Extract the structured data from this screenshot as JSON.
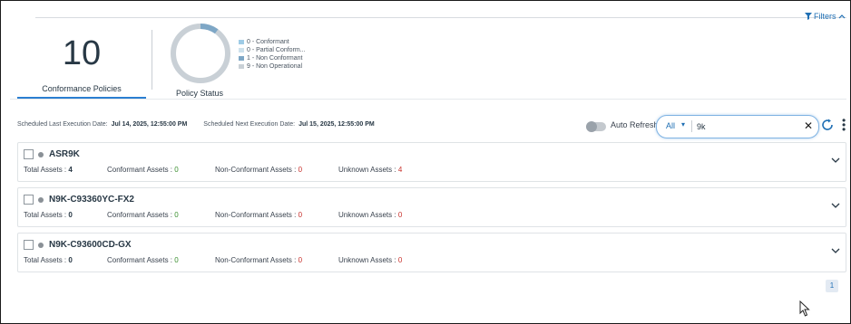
{
  "filters": {
    "label": "Filters"
  },
  "kpi": {
    "value": "10",
    "label": "Conformance Policies"
  },
  "policy_status": {
    "label": "Policy Status",
    "legend": [
      {
        "text": "0 - Conformant",
        "color": "#9ecbe6"
      },
      {
        "text": "0 - Partial Conform...",
        "color": "#cde1ec"
      },
      {
        "text": "1 - Non Conformant",
        "color": "#7ea7c6"
      },
      {
        "text": "9 - Non Operational",
        "color": "#c9d0d6"
      }
    ]
  },
  "schedule": {
    "last_label": "Scheduled Last Execution Date:",
    "last_value": "Jul 14, 2025, 12:55:00 PM",
    "next_label": "Scheduled Next Execution Date:",
    "next_value": "Jul 15, 2025, 12:55:00 PM"
  },
  "auto_refresh": {
    "label": "Auto Refresh",
    "enabled": false
  },
  "search": {
    "scope": "All",
    "value": "9k"
  },
  "cards": [
    {
      "name": "ASR9K",
      "total_label": "Total Assets :",
      "total": "4",
      "conf_label": "Conformant Assets :",
      "conf": "0",
      "nonconf_label": "Non-Conformant Assets :",
      "nonconf": "0",
      "unknown_label": "Unknown Assets :",
      "unknown": "4"
    },
    {
      "name": "N9K-C93360YC-FX2",
      "total_label": "Total Assets :",
      "total": "0",
      "conf_label": "Conformant Assets :",
      "conf": "0",
      "nonconf_label": "Non-Conformant Assets :",
      "nonconf": "0",
      "unknown_label": "Unknown Assets :",
      "unknown": "0"
    },
    {
      "name": "N9K-C93600CD-GX",
      "total_label": "Total Assets :",
      "total": "0",
      "conf_label": "Conformant Assets :",
      "conf": "0",
      "nonconf_label": "Non-Conformant Assets :",
      "nonconf": "0",
      "unknown_label": "Unknown Assets :",
      "unknown": "0"
    }
  ],
  "pagination": {
    "current": "1"
  },
  "colors": {
    "accent": "#1f6fb4",
    "green": "#3a8f2f",
    "red": "#c8312c"
  }
}
